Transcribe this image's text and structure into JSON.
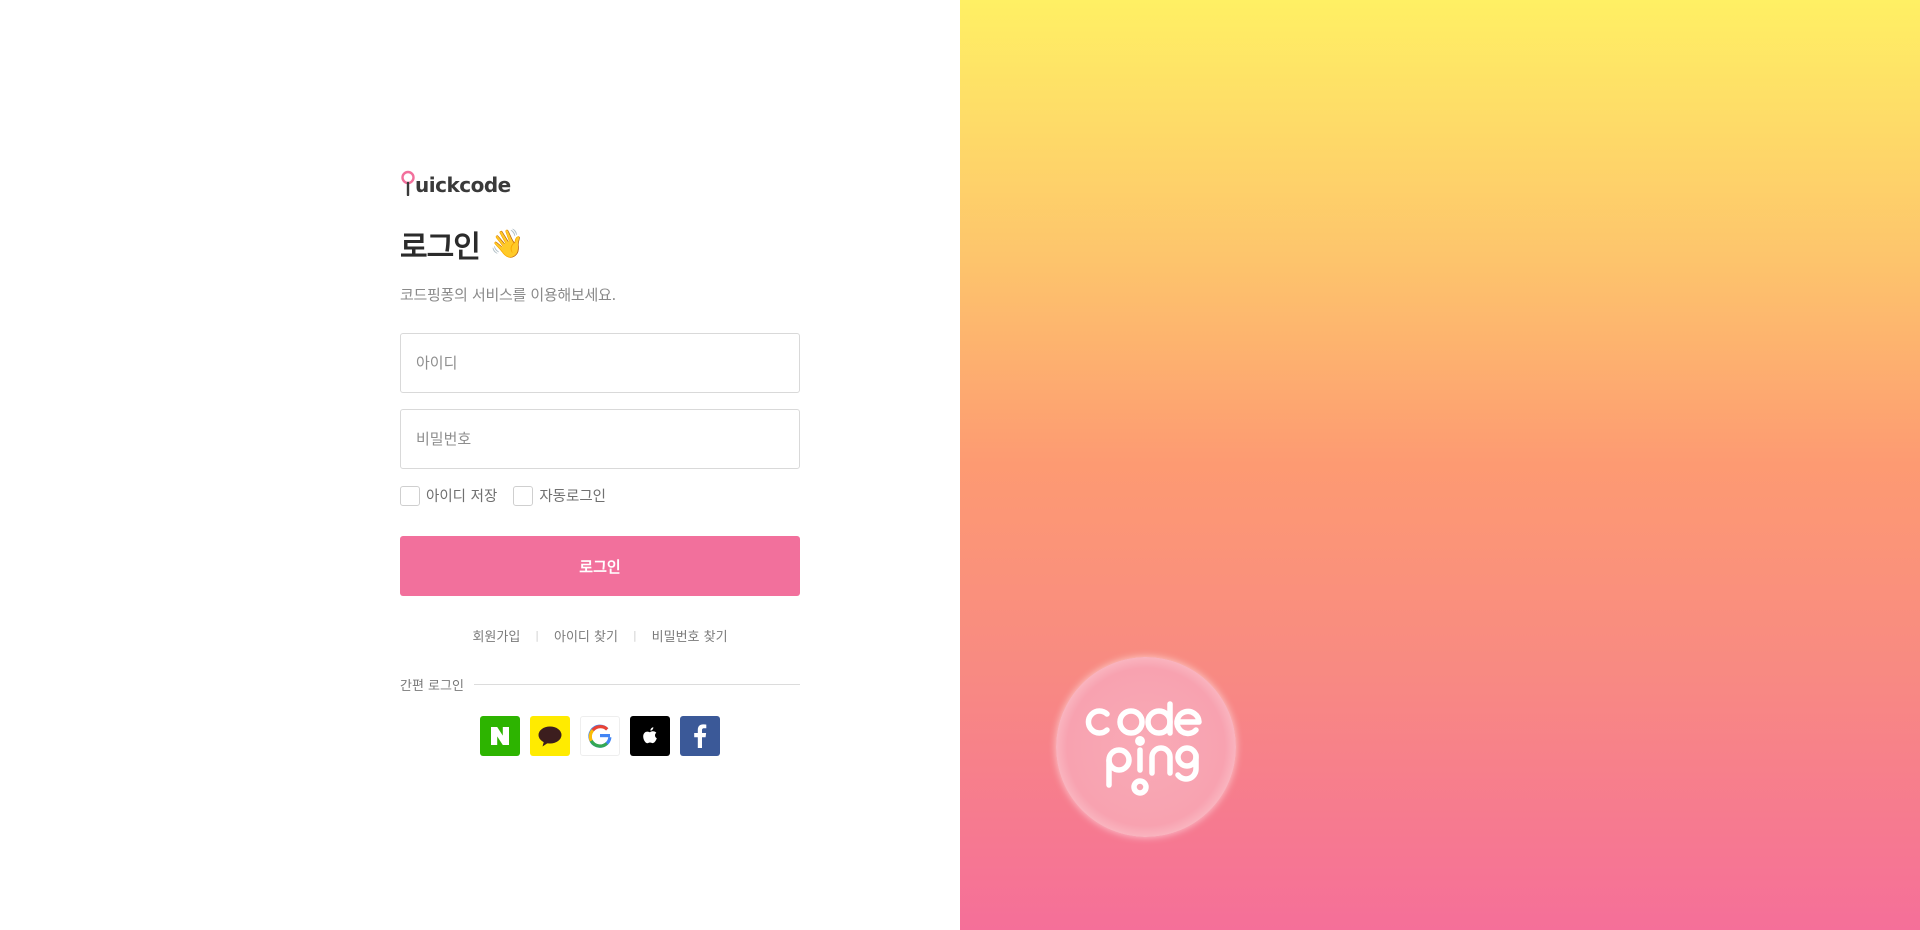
{
  "brand": {
    "logo_text": "uickcode",
    "logo_mark": "Q-pin-icon"
  },
  "login": {
    "title": "로그인",
    "title_emoji": "👋",
    "subtitle": "코드핑퐁의 서비스를 이용해보세요.",
    "id_placeholder": "아이디",
    "pw_placeholder": "비밀번호",
    "remember_id": "아이디 저장",
    "auto_login": "자동로그인",
    "submit": "로그인"
  },
  "links": {
    "signup": "회원가입",
    "find_id": "아이디 찾기",
    "find_pw": "비밀번호 찾기",
    "separator": "|"
  },
  "simple_login": {
    "label": "간편 로그인",
    "providers": [
      {
        "name": "naver",
        "icon": "naver-icon"
      },
      {
        "name": "kakao",
        "icon": "kakao-icon"
      },
      {
        "name": "google",
        "icon": "google-icon"
      },
      {
        "name": "apple",
        "icon": "apple-icon"
      },
      {
        "name": "facebook",
        "icon": "facebook-icon"
      }
    ]
  },
  "hero": {
    "badge_text": "code ping"
  },
  "colors": {
    "accent": "#f2709c",
    "naver": "#2db400",
    "kakao": "#ffeb00",
    "facebook": "#3b5998",
    "gradient_top": "#fff064",
    "gradient_bottom": "#f56f99"
  }
}
